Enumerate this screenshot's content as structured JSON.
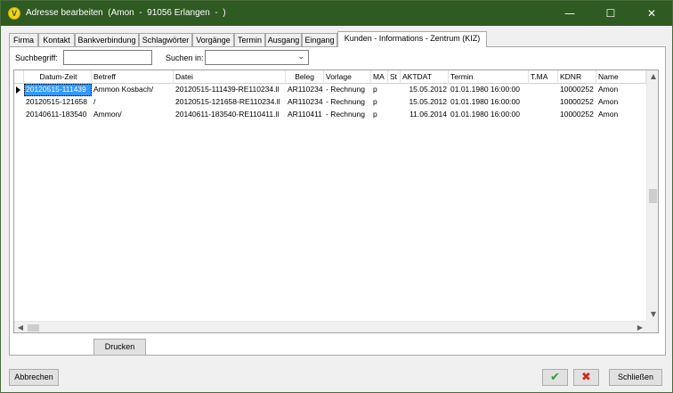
{
  "window": {
    "title": "Adresse bearbeiten  (Amon  -  91056 Erlangen  -  )",
    "icon": "app-logo-icon",
    "minimize_icon": "minimize-icon",
    "maximize_icon": "maximize-icon",
    "close_icon": "close-icon"
  },
  "tabs": [
    {
      "label": "Firma",
      "active": false
    },
    {
      "label": "Kontakt",
      "active": false
    },
    {
      "label": "Bankverbindung",
      "active": false
    },
    {
      "label": "Schlagwörter",
      "active": false
    },
    {
      "label": "Vorgänge",
      "active": false
    },
    {
      "label": "Termin",
      "active": false
    },
    {
      "label": "Ausgang",
      "active": false
    },
    {
      "label": "Eingang",
      "active": false
    },
    {
      "label": "Kunden - Informations - Zentrum (KIZ)",
      "active": true
    }
  ],
  "search": {
    "label": "Suchbegriff:",
    "value": "",
    "search_in_label": "Suchen in:",
    "search_in_value": ""
  },
  "grid": {
    "columns": [
      "Datum-Zeit",
      "Betreff",
      "Datei",
      "Beleg",
      "Vorlage",
      "MA",
      "St",
      "AKTDAT",
      "Termin",
      "T.MA",
      "KDNR",
      "Name"
    ],
    "rows": [
      [
        "20120515-111439",
        "Ammon Kosbach/",
        "20120515-111439-RE110234.ll",
        "AR110234",
        "- Rechnung",
        "p",
        "",
        "15.05.2012",
        "01.01.1980 16:00:00",
        "",
        "10000252",
        "Amon"
      ],
      [
        "20120515-121658",
        "/",
        "20120515-121658-RE110234.ll",
        "AR110234",
        "- Rechnung",
        "p",
        "",
        "15.05.2012",
        "01.01.1980 16:00:00",
        "",
        "10000252",
        "Amon"
      ],
      [
        "20140611-183540",
        "Ammon/",
        "20140611-183540-RE110411.ll",
        "AR110411",
        "- Rechnung",
        "p",
        "",
        "11.06.2014",
        "01.01.1980 16:00:00",
        "",
        "10000252",
        "Amon"
      ]
    ],
    "selected_row": 0
  },
  "buttons": {
    "print": "Drucken",
    "cancel": "Abbrechen",
    "ok_icon": "checkmark-icon",
    "delete_icon": "x-mark-icon",
    "close": "Schließen"
  },
  "colors": {
    "titlebar": "#2f5a22",
    "selection": "#3399ff",
    "ok_green": "#2e9b3a",
    "delete_red": "#d12a1a"
  }
}
